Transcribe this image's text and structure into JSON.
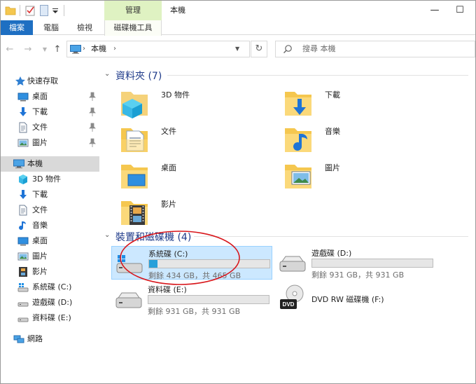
{
  "titlebar": {
    "tool_tab_group": "管理",
    "window_title": "本機",
    "minimize": "—",
    "maximize": "☐"
  },
  "ribbon": {
    "tabs": [
      {
        "label": "檔案"
      },
      {
        "label": "電腦"
      },
      {
        "label": "檢視"
      },
      {
        "label": "磁碟機工具"
      }
    ]
  },
  "address": {
    "path": "本機",
    "search_placeholder": "搜尋 本機"
  },
  "sidebar": {
    "quick_access": {
      "label": "快速存取"
    },
    "quick_items": [
      {
        "label": "桌面"
      },
      {
        "label": "下載"
      },
      {
        "label": "文件"
      },
      {
        "label": "圖片"
      }
    ],
    "this_pc": {
      "label": "本機"
    },
    "pc_items": [
      {
        "label": "3D 物件"
      },
      {
        "label": "下載"
      },
      {
        "label": "文件"
      },
      {
        "label": "音樂"
      },
      {
        "label": "桌面"
      },
      {
        "label": "圖片"
      },
      {
        "label": "影片"
      },
      {
        "label": "系統碟 (C:)"
      },
      {
        "label": "遊戲碟 (D:)"
      },
      {
        "label": "資料碟 (E:)"
      }
    ],
    "network": {
      "label": "網路"
    }
  },
  "folders_group": {
    "title": "資料夾 (7)",
    "items": [
      {
        "label": "3D 物件",
        "icon": "3d-objects-icon"
      },
      {
        "label": "下載",
        "icon": "download-folder-icon"
      },
      {
        "label": "文件",
        "icon": "documents-folder-icon"
      },
      {
        "label": "音樂",
        "icon": "music-folder-icon"
      },
      {
        "label": "桌面",
        "icon": "desktop-folder-icon"
      },
      {
        "label": "圖片",
        "icon": "pictures-folder-icon"
      },
      {
        "label": "影片",
        "icon": "videos-folder-icon"
      }
    ]
  },
  "devices_group": {
    "title": "裝置和磁碟機 (4)",
    "drives": [
      {
        "name": "系統碟 (C:)",
        "space": "剩餘 434 GB，共 465 GB",
        "used_fraction": 0.067
      },
      {
        "name": "遊戲碟 (D:)",
        "space": "剩餘 931 GB，共 931 GB",
        "used_fraction": 0.0
      },
      {
        "name": "資料碟 (E:)",
        "space": "剩餘 931 GB，共 931 GB",
        "used_fraction": 0.0
      },
      {
        "name": "DVD RW 磁碟機 (F:)"
      }
    ]
  },
  "colors": {
    "accent": "#1e6fc2",
    "tool_tab": "#dff2c2",
    "selection": "#cce8ff",
    "drive_bar": "#26a0da",
    "annotation": "#d8161b"
  }
}
